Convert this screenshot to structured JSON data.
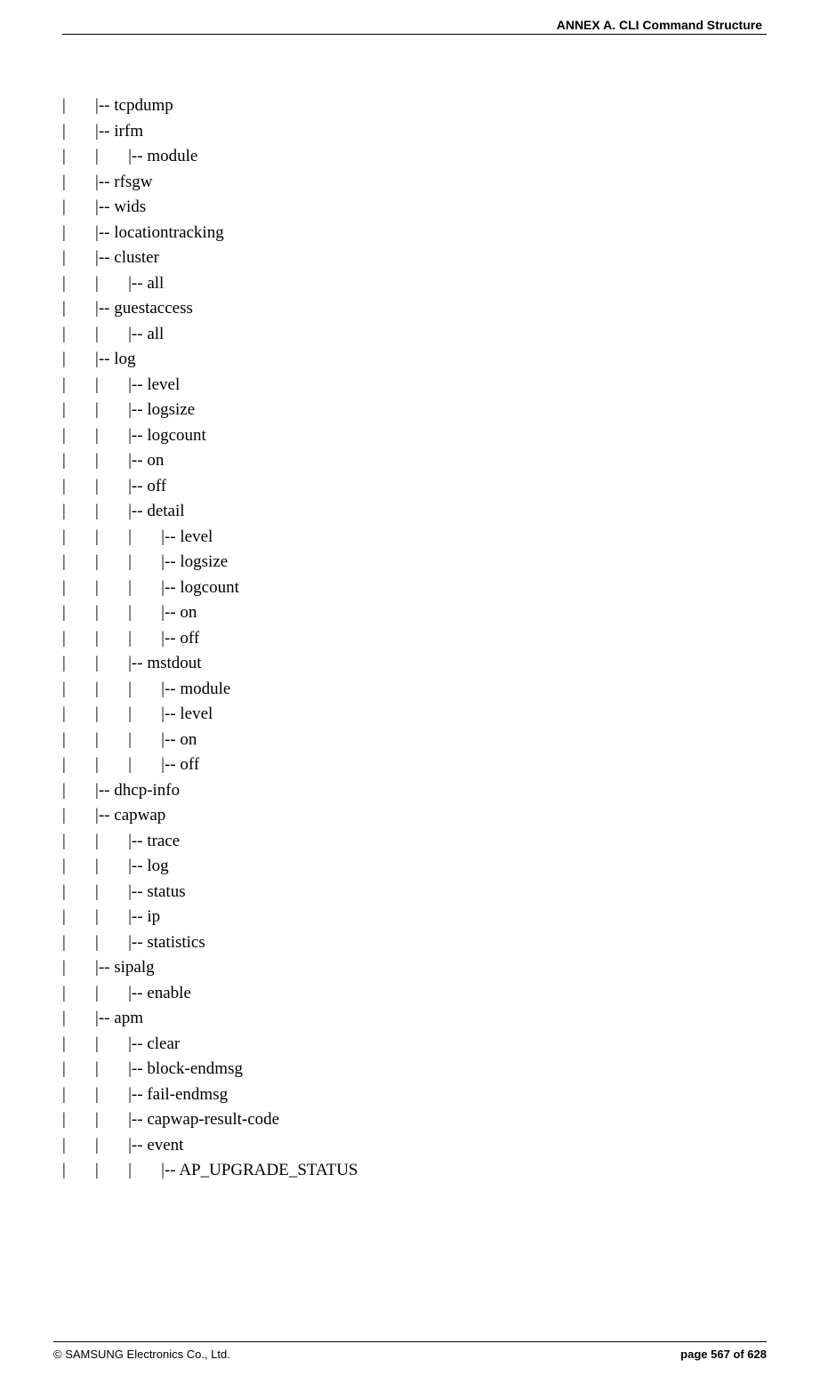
{
  "header": {
    "title": "ANNEX A. CLI Command Structure"
  },
  "tree": {
    "lines": [
      "|       |-- tcpdump",
      "|       |-- irfm",
      "|       |       |-- module",
      "|       |-- rfsgw",
      "|       |-- wids",
      "|       |-- locationtracking",
      "|       |-- cluster",
      "|       |       |-- all",
      "|       |-- guestaccess",
      "|       |       |-- all",
      "|       |-- log",
      "|       |       |-- level",
      "|       |       |-- logsize",
      "|       |       |-- logcount",
      "|       |       |-- on",
      "|       |       |-- off",
      "|       |       |-- detail",
      "|       |       |       |-- level",
      "|       |       |       |-- logsize",
      "|       |       |       |-- logcount",
      "|       |       |       |-- on",
      "|       |       |       |-- off",
      "|       |       |-- mstdout",
      "|       |       |       |-- module",
      "|       |       |       |-- level",
      "|       |       |       |-- on",
      "|       |       |       |-- off",
      "|       |-- dhcp-info",
      "|       |-- capwap",
      "|       |       |-- trace",
      "|       |       |-- log",
      "|       |       |-- status",
      "|       |       |-- ip",
      "|       |       |-- statistics",
      "|       |-- sipalg",
      "|       |       |-- enable",
      "|       |-- apm",
      "|       |       |-- clear",
      "|       |       |-- block-endmsg",
      "|       |       |-- fail-endmsg",
      "|       |       |-- capwap-result-code",
      "|       |       |-- event",
      "|       |       |       |-- AP_UPGRADE_STATUS"
    ]
  },
  "footer": {
    "left": "© SAMSUNG Electronics Co., Ltd.",
    "right": "page 567 of 628"
  }
}
